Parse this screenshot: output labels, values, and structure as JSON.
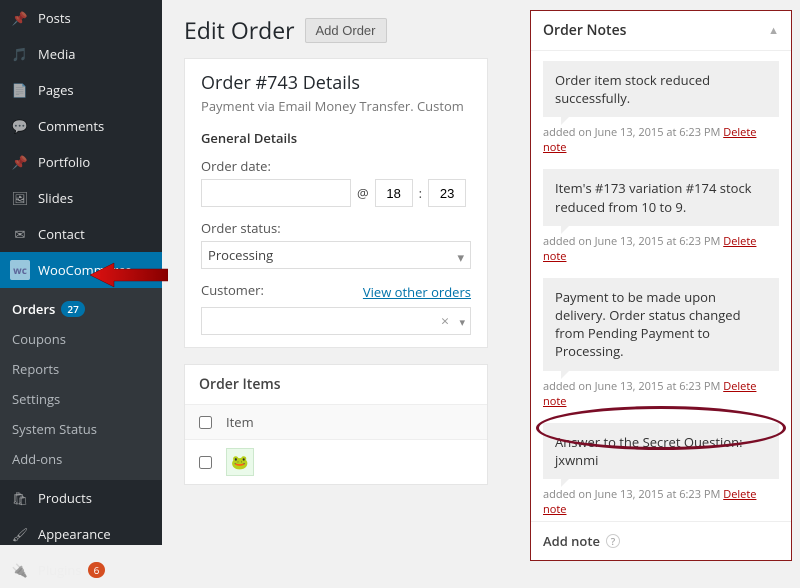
{
  "sidebar": {
    "items": [
      {
        "icon": "pin",
        "label": "Posts"
      },
      {
        "icon": "media",
        "label": "Media"
      },
      {
        "icon": "page",
        "label": "Pages"
      },
      {
        "icon": "comment",
        "label": "Comments"
      },
      {
        "icon": "pin",
        "label": "Portfolio"
      },
      {
        "icon": "slides",
        "label": "Slides"
      },
      {
        "icon": "mail",
        "label": "Contact"
      }
    ],
    "woocommerce_label": "WooCommerce",
    "submenu": [
      {
        "label": "Orders",
        "badge": "27",
        "current": true
      },
      {
        "label": "Coupons"
      },
      {
        "label": "Reports"
      },
      {
        "label": "Settings"
      },
      {
        "label": "System Status"
      },
      {
        "label": "Add-ons"
      }
    ],
    "bottom": [
      {
        "icon": "products",
        "label": "Products"
      },
      {
        "icon": "appearance",
        "label": "Appearance"
      },
      {
        "icon": "plugins",
        "label": "Plugins",
        "badge": "6"
      }
    ]
  },
  "header": {
    "title": "Edit Order",
    "add_button": "Add Order"
  },
  "details": {
    "heading": "Order #743 Details",
    "sub": "Payment via Email Money Transfer. Custom",
    "general_heading": "General Details",
    "date_label": "Order date:",
    "at": "@",
    "colon": ":",
    "hour": "18",
    "minute": "23",
    "status_label": "Order status:",
    "status_value": "Processing",
    "customer_label": "Customer:",
    "view_other": "View other orders"
  },
  "items": {
    "panel_title": "Order Items",
    "col_item": "Item"
  },
  "notes": {
    "title": "Order Notes",
    "entries": [
      {
        "body": "Order item stock reduced successfully.",
        "meta_prefix": "added on ",
        "meta_date": "June 13, 2015 at 6:23 PM",
        "delete": "Delete note"
      },
      {
        "body": "Item's #173 variation #174 stock reduced from 10 to 9.",
        "meta_prefix": "added on ",
        "meta_date": "June 13, 2015 at 6:23 PM",
        "delete": "Delete note"
      },
      {
        "body": "Payment to be made upon delivery. Order status changed from Pending Payment to Processing.",
        "meta_prefix": "added on ",
        "meta_date": "June 13, 2015 at 6:23 PM",
        "delete": "Delete note"
      },
      {
        "body": "Answer to the Secret Question: jxwnmi",
        "meta_prefix": "added on ",
        "meta_date": "June 13, 2015 at 6:23 PM",
        "delete": "Delete note"
      }
    ],
    "add_note": "Add note"
  }
}
